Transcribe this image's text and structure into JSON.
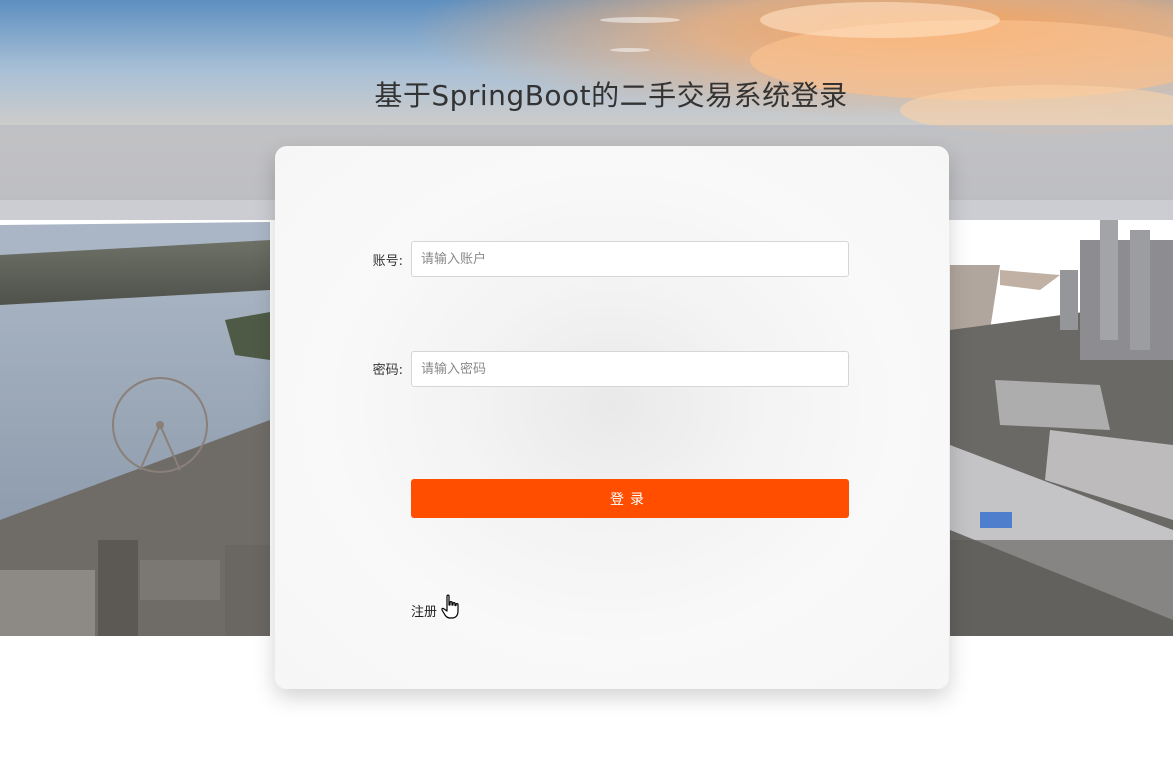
{
  "page": {
    "title": "基于SpringBoot的二手交易系统登录"
  },
  "login_form": {
    "account_label": "账号:",
    "account_placeholder": "请输入账户",
    "account_value": "",
    "password_label": "密码:",
    "password_placeholder": "请输入密码",
    "password_value": "",
    "submit_label": "登录",
    "register_link": "注册"
  },
  "colors": {
    "accent": "#ff4e00",
    "title_text": "#333333",
    "card_background": "#f6f6f6"
  },
  "icons": {
    "cursor": "hand-pointer-cursor-icon"
  }
}
